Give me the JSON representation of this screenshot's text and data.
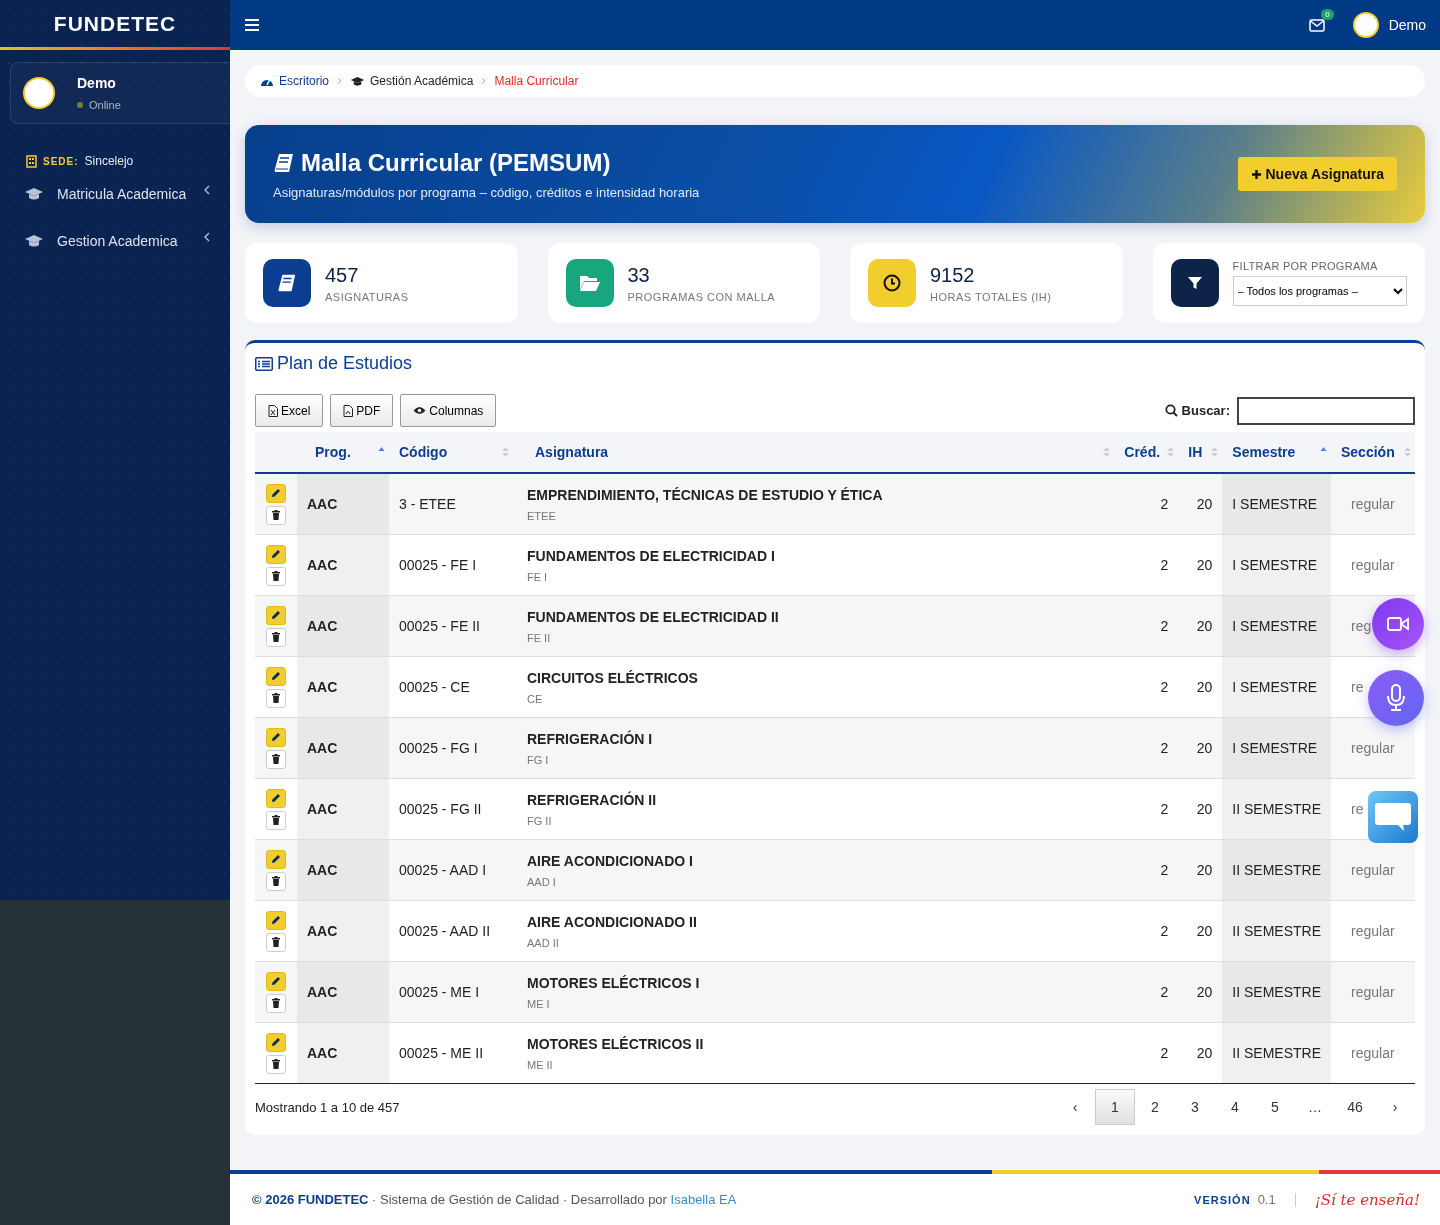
{
  "sidebar": {
    "brand": "FUNDETEC",
    "user": {
      "name": "Demo",
      "status": "Online"
    },
    "sede_label": "SEDE:",
    "sede": "Sincelejo",
    "items": [
      {
        "label": "Matricula Academica",
        "expanded": false
      },
      {
        "label": "Gestion Academica",
        "expanded": false
      }
    ]
  },
  "topbar": {
    "mail_count": "0",
    "user": "Demo"
  },
  "breadcrumb": [
    {
      "label": "Escritorio"
    },
    {
      "label": "Gestión Académica"
    },
    {
      "label": "Malla Curricular"
    }
  ],
  "hero": {
    "title": "Malla Curricular (PEMSUM)",
    "subtitle": "Asignaturas/módulos por programa – código, créditos e intensidad horaria",
    "button": "Nueva Asignatura"
  },
  "stats": [
    {
      "value": "457",
      "label": "ASIGNATURAS",
      "kind": "book",
      "color": "#0b3d91"
    },
    {
      "value": "33",
      "label": "PROGRAMAS CON MALLA",
      "kind": "folder",
      "color": "#17a67e"
    },
    {
      "value": "9152",
      "label": "HORAS TOTALES (IH)",
      "kind": "clock",
      "color": "#f2cd2e"
    }
  ],
  "filter": {
    "label": "FILTRAR POR PROGRAMA",
    "value": "– Todos los programas –"
  },
  "table_card": {
    "title": "Plan de Estudios",
    "buttons": [
      {
        "label": "Excel"
      },
      {
        "label": "PDF"
      },
      {
        "label": "Columnas"
      }
    ],
    "search_label": "Buscar:",
    "columns": [
      {
        "label": "Prog.",
        "sorted": true
      },
      {
        "label": "Código",
        "sorted": false
      },
      {
        "label": "Asignatura",
        "sorted": false
      },
      {
        "label": "Créd.",
        "sorted": false
      },
      {
        "label": "IH",
        "sorted": false
      },
      {
        "label": "Semestre",
        "sorted": true
      },
      {
        "label": "Sección",
        "sorted": false
      }
    ],
    "rows": [
      {
        "prog": "AAC",
        "code": "3 - ETEE",
        "name": "EMPRENDIMIENTO, TÉCNICAS DE ESTUDIO Y ÉTICA",
        "abbr": "ETEE",
        "cred": "2",
        "ih": "20",
        "semester": "I SEMESTRE",
        "section": "regular"
      },
      {
        "prog": "AAC",
        "code": "00025 - FE I",
        "name": "FUNDAMENTOS DE ELECTRICIDAD I",
        "abbr": "FE I",
        "cred": "2",
        "ih": "20",
        "semester": "I SEMESTRE",
        "section": "regular"
      },
      {
        "prog": "AAC",
        "code": "00025 - FE II",
        "name": "FUNDAMENTOS DE ELECTRICIDAD II",
        "abbr": "FE II",
        "cred": "2",
        "ih": "20",
        "semester": "I SEMESTRE",
        "section": "reg"
      },
      {
        "prog": "AAC",
        "code": "00025 - CE",
        "name": "CIRCUITOS ELÉCTRICOS",
        "abbr": "CE",
        "cred": "2",
        "ih": "20",
        "semester": "I SEMESTRE",
        "section": "re"
      },
      {
        "prog": "AAC",
        "code": "00025 - FG I",
        "name": "REFRIGERACIÓN I",
        "abbr": "FG I",
        "cred": "2",
        "ih": "20",
        "semester": "I SEMESTRE",
        "section": "regular"
      },
      {
        "prog": "AAC",
        "code": "00025 - FG II",
        "name": "REFRIGERACIÓN II",
        "abbr": "FG II",
        "cred": "2",
        "ih": "20",
        "semester": "II SEMESTRE",
        "section": "re"
      },
      {
        "prog": "AAC",
        "code": "00025 - AAD I",
        "name": "AIRE ACONDICIONADO I",
        "abbr": "AAD I",
        "cred": "2",
        "ih": "20",
        "semester": "II SEMESTRE",
        "section": "regular"
      },
      {
        "prog": "AAC",
        "code": "00025 - AAD II",
        "name": "AIRE ACONDICIONADO II",
        "abbr": "AAD II",
        "cred": "2",
        "ih": "20",
        "semester": "II SEMESTRE",
        "section": "regular"
      },
      {
        "prog": "AAC",
        "code": "00025 - ME I",
        "name": "MOTORES ELÉCTRICOS I",
        "abbr": "ME I",
        "cred": "2",
        "ih": "20",
        "semester": "II SEMESTRE",
        "section": "regular"
      },
      {
        "prog": "AAC",
        "code": "00025 - ME II",
        "name": "MOTORES ELÉCTRICOS II",
        "abbr": "ME II",
        "cred": "2",
        "ih": "20",
        "semester": "II SEMESTRE",
        "section": "regular"
      }
    ],
    "info": "Mostrando 1 a 10 de 457",
    "pages": [
      {
        "label": "‹",
        "selected": false
      },
      {
        "label": "1",
        "selected": true
      },
      {
        "label": "2",
        "selected": false
      },
      {
        "label": "3",
        "selected": false
      },
      {
        "label": "4",
        "selected": false
      },
      {
        "label": "5",
        "selected": false
      },
      {
        "label": "…",
        "selected": false
      },
      {
        "label": "46",
        "selected": false
      },
      {
        "label": "›",
        "selected": false
      }
    ]
  },
  "footer": {
    "text": "**© 2026 FUNDETEC** · Sistema de Gestión de Calidad · Desarrollado por",
    "link": "Isabella EA",
    "version_label": "VERSIÓN",
    "version": "0.1",
    "slogan": "¡Sí te enseña!"
  }
}
